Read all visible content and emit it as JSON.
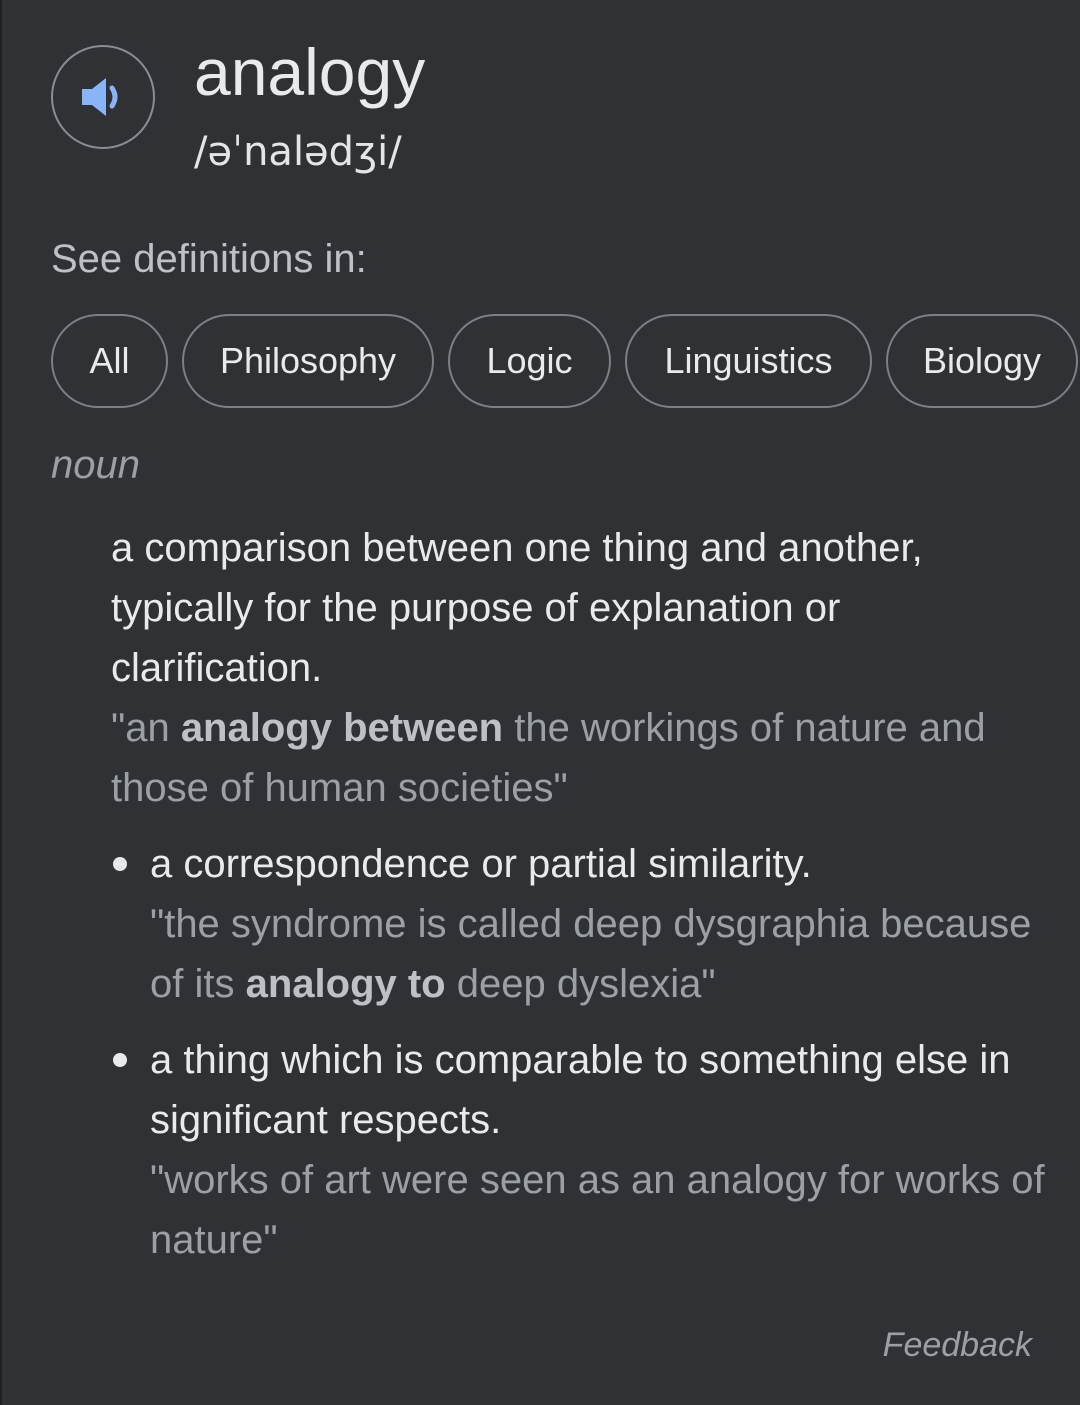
{
  "entry": {
    "word": "analogy",
    "phonetic": "/əˈnalədʒi/",
    "speaker_icon": "speaker-icon",
    "speaker_color": "#8ab4f8"
  },
  "see_definitions": {
    "label": "See definitions in:",
    "chips": [
      "All",
      "Philosophy",
      "Logic",
      "Linguistics",
      "Biology"
    ]
  },
  "part_of_speech": "noun",
  "definitions": [
    {
      "text": "a comparison between one thing and another, typically for the purpose of explanation or clarification.",
      "example": {
        "before": "\"an ",
        "bold": "analogy between",
        "after": " the workings of nature and those of human societies\""
      }
    },
    {
      "text": "a correspondence or partial similarity.",
      "example": {
        "before": "\"the syndrome is called deep dysgraphia because of its ",
        "bold": "analogy to",
        "after": " deep dyslexia\""
      }
    },
    {
      "text": "a thing which is comparable to something else in significant respects.",
      "example": {
        "before": "\"works of art were seen as an analogy for works of nature\"",
        "bold": "",
        "after": ""
      }
    }
  ],
  "feedback_label": "Feedback",
  "colors": {
    "background": "#303134",
    "text": "#e8eaed",
    "muted": "#9aa0a6",
    "chip_border": "#7c7f84"
  }
}
